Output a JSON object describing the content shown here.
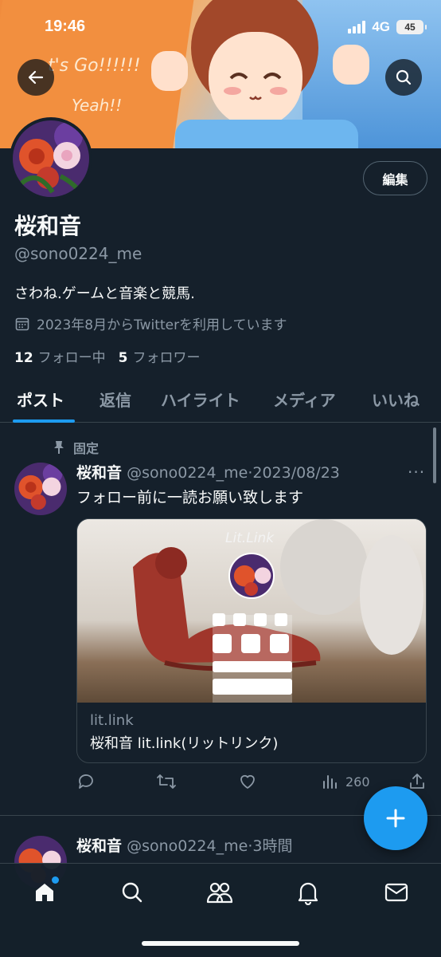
{
  "status_bar": {
    "time": "19:46",
    "network": "4G",
    "battery": "45"
  },
  "banner": {
    "text1": "t's Go!!!!!!",
    "text2": "Yeah!!"
  },
  "header": {
    "edit_label": "編集"
  },
  "profile": {
    "name": "桜和音",
    "handle": "@sono0224_me",
    "bio": "さわね.ゲームと音楽と競馬.",
    "joined": "2023年8月からTwitterを利用しています",
    "following_count": "12",
    "following_label": "フォロー中",
    "followers_count": "5",
    "followers_label": "フォロワー"
  },
  "tabs": [
    {
      "label": "ポスト",
      "active": true
    },
    {
      "label": "返信",
      "active": false
    },
    {
      "label": "ハイライト",
      "active": false
    },
    {
      "label": "メディア",
      "active": false
    },
    {
      "label": "いいね",
      "active": false
    }
  ],
  "pinned_label": "固定",
  "tweets": [
    {
      "name": "桜和音",
      "handle": "@sono0224_me",
      "separator": "·",
      "time": "2023/08/23",
      "text": "フォロー前に一読お願い致します",
      "card": {
        "logo": "Lit.Link",
        "domain": "lit.link",
        "title": "桜和音 lit.link(リットリンク)"
      },
      "views": "260"
    },
    {
      "name": "桜和音",
      "handle": "@sono0224_me",
      "separator": "·",
      "time": "3時間"
    }
  ],
  "colors": {
    "accent": "#1d9bf0",
    "background": "#15202b",
    "muted": "#8b98a5"
  }
}
